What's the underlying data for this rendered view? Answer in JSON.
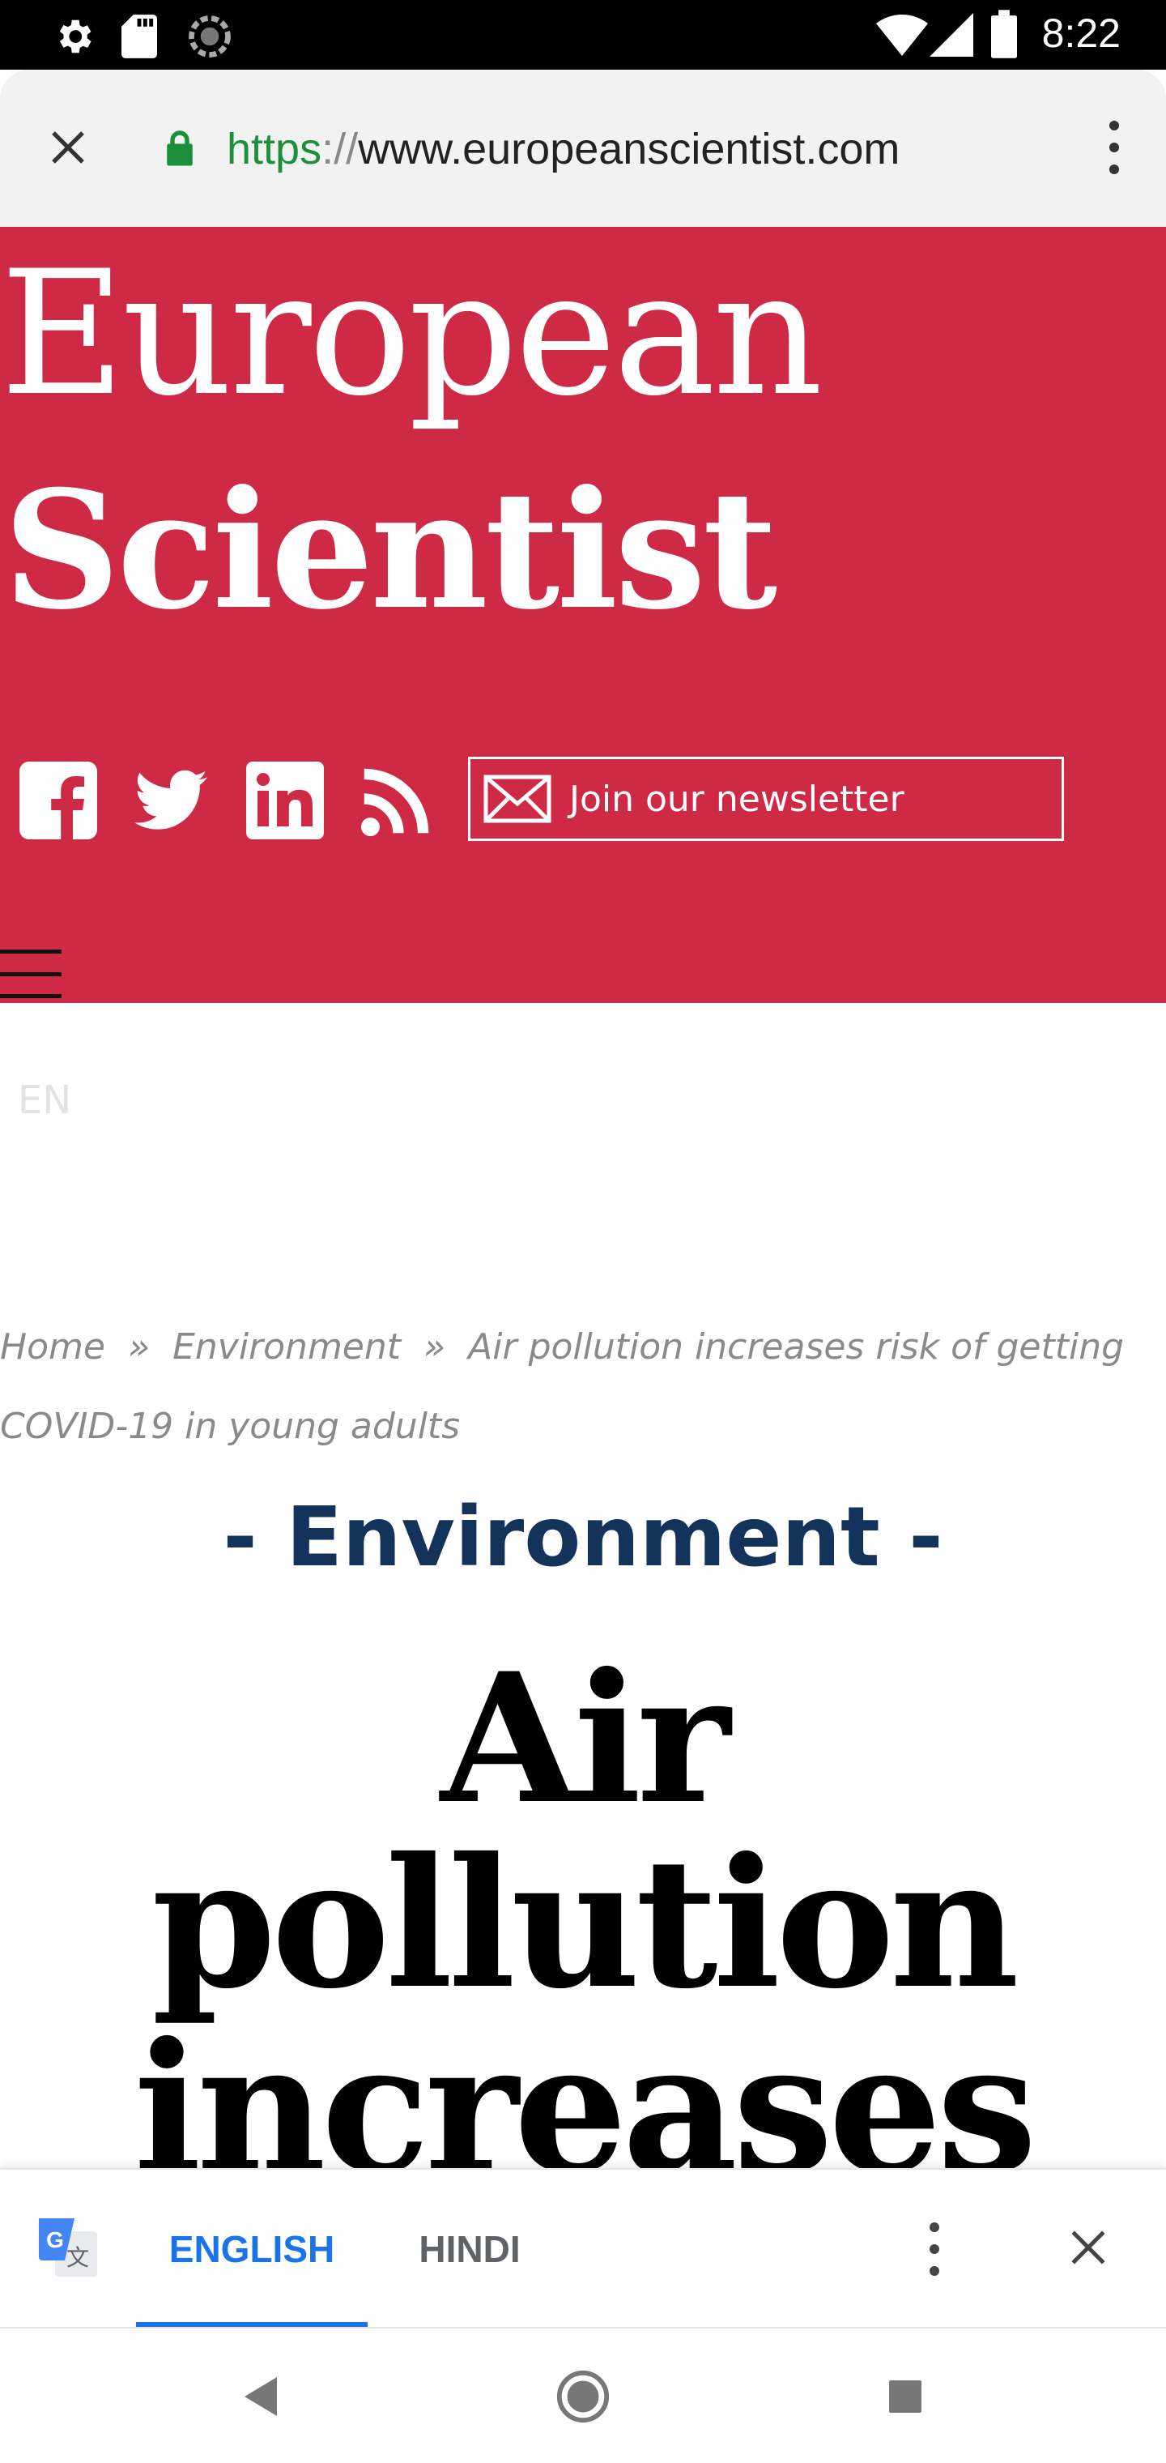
{
  "status_bar": {
    "time": "8:22",
    "left_icons": [
      "settings-icon",
      "sd-card-icon",
      "sync-icon"
    ],
    "right_icons": [
      "wifi-icon",
      "signal-icon",
      "battery-icon"
    ]
  },
  "browser": {
    "url_scheme": "https",
    "url_separator": "://",
    "url_host": "www.europeanscientist.com",
    "close_icon": "close-icon",
    "lock_icon": "lock-icon",
    "menu_icon": "more-vert-icon",
    "colors": {
      "secure": "#1b8f3a",
      "chrome_bg": "#f2f2f2"
    }
  },
  "site": {
    "logo_line1": "European",
    "logo_line2": "Scientist",
    "header_color": "#cf2a45",
    "social_icons": [
      "facebook-icon",
      "twitter-icon",
      "linkedin-icon",
      "rss-icon"
    ],
    "newsletter_label": "Join our newsletter",
    "menu_icon": "hamburger-icon",
    "language": "EN"
  },
  "breadcrumb": {
    "items": [
      "Home",
      "Environment",
      "Air pollution increases risk of getting COVID-19 in young adults"
    ],
    "separator": "»"
  },
  "article": {
    "category": "- Environment -",
    "headline": "Air pollution increases risk of getting",
    "category_color": "#13335a"
  },
  "translate_bar": {
    "icon": "google-translate-icon",
    "tabs": [
      {
        "label": "ENGLISH",
        "active": true
      },
      {
        "label": "HINDI",
        "active": false
      }
    ],
    "menu_icon": "more-vert-icon",
    "close_icon": "close-icon",
    "accent_color": "#1a73e8"
  },
  "nav_bar": {
    "buttons": [
      "back-icon",
      "home-icon",
      "recents-icon"
    ]
  }
}
